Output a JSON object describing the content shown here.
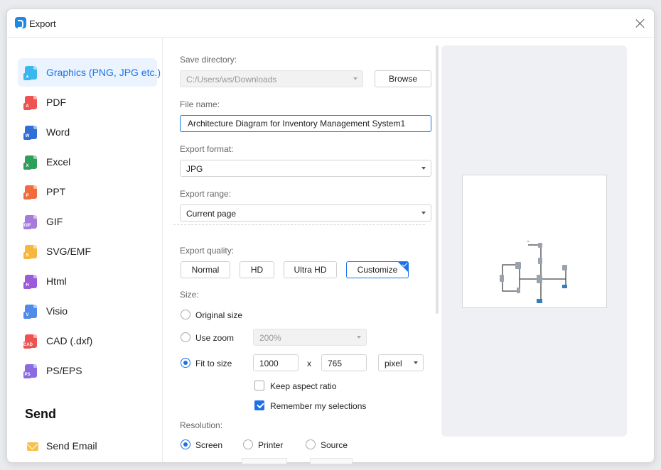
{
  "window": {
    "title": "Export",
    "close_label": "×"
  },
  "sidebar": {
    "items": [
      {
        "label": "Graphics (PNG, JPG etc.)",
        "icon": "image-file-icon",
        "color": "#3bb7f0",
        "glyph": "▲",
        "active": true
      },
      {
        "label": "PDF",
        "icon": "pdf-file-icon",
        "color": "#ef5350",
        "glyph": "A"
      },
      {
        "label": "Word",
        "icon": "word-file-icon",
        "color": "#2f6fd6",
        "glyph": "W"
      },
      {
        "label": "Excel",
        "icon": "excel-file-icon",
        "color": "#2e9e5b",
        "glyph": "X"
      },
      {
        "label": "PPT",
        "icon": "ppt-file-icon",
        "color": "#f26b3a",
        "glyph": "P"
      },
      {
        "label": "GIF",
        "icon": "gif-file-icon",
        "color": "#a77bdb",
        "glyph": "GIF"
      },
      {
        "label": "SVG/EMF",
        "icon": "svg-file-icon",
        "color": "#f4b740",
        "glyph": "S"
      },
      {
        "label": "Html",
        "icon": "html-file-icon",
        "color": "#9c5bd8",
        "glyph": "H"
      },
      {
        "label": "Visio",
        "icon": "visio-file-icon",
        "color": "#4f8be8",
        "glyph": "V"
      },
      {
        "label": "CAD (.dxf)",
        "icon": "cad-file-icon",
        "color": "#ef5350",
        "glyph": "CAD"
      },
      {
        "label": "PS/EPS",
        "icon": "ps-file-icon",
        "color": "#8a6be0",
        "glyph": "PS"
      }
    ],
    "send_heading": "Send",
    "send_email": "Send Email"
  },
  "form": {
    "save_directory_label": "Save directory:",
    "save_directory_value": "C:/Users/ws/Downloads",
    "browse_label": "Browse",
    "file_name_label": "File name:",
    "file_name_value": "Architecture Diagram for Inventory Management System1",
    "export_format_label": "Export format:",
    "export_format_value": "JPG",
    "export_range_label": "Export range:",
    "export_range_value": "Current page",
    "export_quality_label": "Export quality:",
    "quality_options": [
      "Normal",
      "HD",
      "Ultra HD",
      "Customize"
    ],
    "quality_selected": "Customize",
    "size_label": "Size:",
    "size_original": "Original size",
    "size_use_zoom": "Use zoom",
    "zoom_value": "200%",
    "size_fit": "Fit to size",
    "width_value": "1000",
    "times": "x",
    "height_value": "765",
    "unit_value": "pixel",
    "keep_aspect": "Keep aspect ratio",
    "keep_aspect_checked": false,
    "remember": "Remember my selections",
    "remember_checked": true,
    "resolution_label": "Resolution:",
    "resolution_options": [
      "Screen",
      "Printer",
      "Source"
    ],
    "resolution_selected": "Screen"
  },
  "colors": {
    "accent": "#1a73e8",
    "preview_bg": "#eef0f4"
  }
}
